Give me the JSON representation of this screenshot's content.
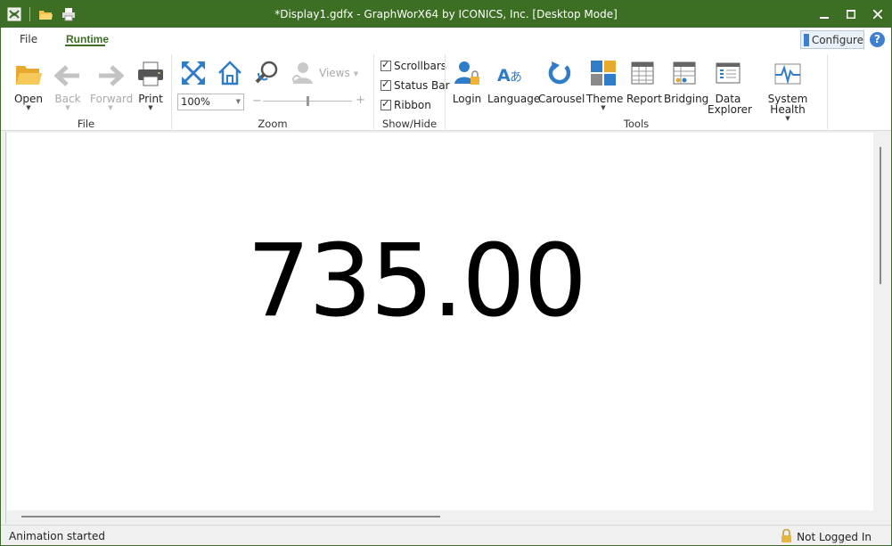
{
  "window": {
    "title": "*Display1.gdfx - GraphWorX64 by ICONICS, Inc. [Desktop Mode]"
  },
  "tabs": {
    "file": "File",
    "runtime": "Runtime"
  },
  "configure_label": "Configure",
  "help_label": "?",
  "groups": {
    "file": "File",
    "zoom": "Zoom",
    "showhide": "Show/Hide",
    "tools": "Tools"
  },
  "buttons": {
    "open": "Open",
    "back": "Back",
    "forward": "Forward",
    "print": "Print",
    "views": "Views",
    "login": "Login",
    "language": "Language",
    "carousel": "Carousel",
    "theme": "Theme",
    "report": "Report",
    "bridging": "Bridging",
    "data_explorer_1": "Data",
    "data_explorer_2": "Explorer",
    "system_health": "System Health"
  },
  "zoom": {
    "value": "100%",
    "slider_level": 0.5
  },
  "checkboxes": {
    "scrollbars": "Scrollbars",
    "status_bar": "Status Bar",
    "ribbon": "Ribbon"
  },
  "display": {
    "value": "735.00"
  },
  "status": {
    "message": "Animation started",
    "login_state": "Not Logged In"
  },
  "colors": {
    "titlebar": "#3c6e24",
    "accent_blue": "#3f7fd0"
  }
}
